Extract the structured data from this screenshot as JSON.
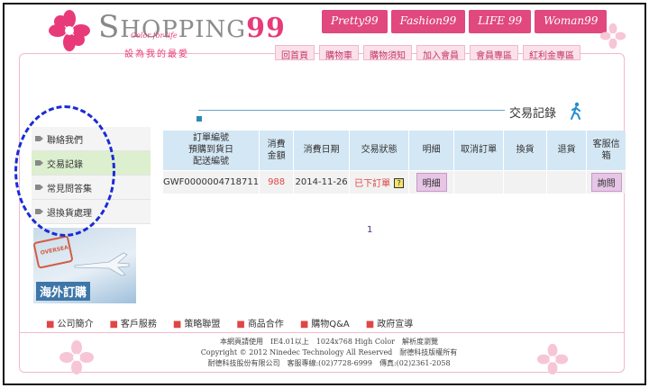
{
  "header": {
    "logo_main": "HOPPING",
    "logo_99": "99",
    "logo_tagline": "Color for life",
    "slogan": "設為我的最愛",
    "brand_tabs": [
      "Pretty99",
      "Fashion99",
      "LIFE 99",
      "Woman99"
    ],
    "nav": [
      "回首頁",
      "購物車",
      "購物須知",
      "加入會員",
      "會員專區",
      "紅利金專區"
    ]
  },
  "section": {
    "title": "交易記錄"
  },
  "sidebar": {
    "items": [
      {
        "label": "聯絡我們"
      },
      {
        "label": "交易記錄"
      },
      {
        "label": "常見問答集"
      },
      {
        "label": "退換貨處理"
      }
    ],
    "banner": {
      "stamp": "OVERSEA",
      "text": "海外訂購"
    }
  },
  "orders": {
    "headers": {
      "order_no": [
        "訂單編號",
        "預購到貨日",
        "配送編號"
      ],
      "amount": [
        "消費",
        "金額"
      ],
      "date": "消費日期",
      "status": "交易狀態",
      "detail": "明細",
      "cancel": "取消訂單",
      "exchange": "換貨",
      "return": "退貨",
      "mailbox": "客服信箱"
    },
    "rows": [
      {
        "order_no": "GWF0000004718711",
        "amount": "988",
        "date": "2014-11-26",
        "status": "已下訂單",
        "detail_btn": "明細",
        "ask_btn": "詢問"
      }
    ],
    "page": "1"
  },
  "footer": {
    "links": [
      "公司簡介",
      "客戶服務",
      "策略聯盟",
      "商品合作",
      "購物Q&A",
      "政府宣導"
    ],
    "info": [
      "本網頁請使用　IE4.01以上　1024x768 High Color　解析度瀏覽",
      "Copyright © 2012 Ninedec Technology All Reserved　耐德科技版權所有",
      "耐德科技股份有限公司　客服專線:(02)7728-6999　傳真:(02)2361-2058"
    ]
  },
  "colors": {
    "brand_pink": "#e0487e",
    "header_blue": "#d4e7f4",
    "annotation_blue": "#1a2bd6"
  }
}
